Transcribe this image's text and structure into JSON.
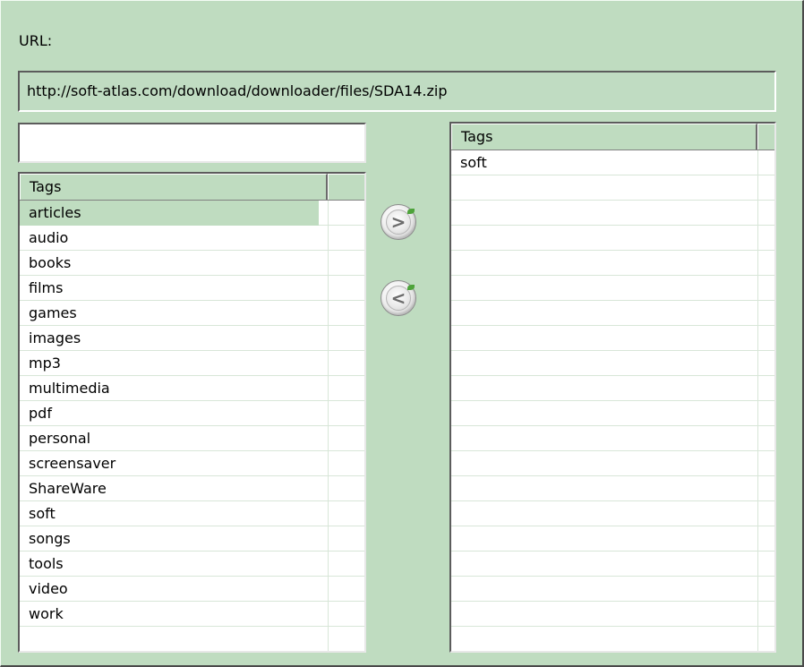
{
  "url_label": "URL:",
  "url_value": "http://soft-atlas.com/download/downloader/files/SDA14.zip",
  "filter": {
    "value": "",
    "placeholder": ""
  },
  "available_tags": {
    "header": "Tags",
    "selected_index": 0,
    "items": [
      "articles",
      "audio",
      "books",
      "films",
      "games",
      "images",
      "mp3",
      "multimedia",
      "pdf",
      "personal",
      "screensaver",
      "ShareWare",
      "soft",
      "songs",
      "tools",
      "video",
      "work"
    ]
  },
  "assigned_tags": {
    "header": "Tags",
    "items": [
      "soft"
    ]
  },
  "buttons": {
    "add_glyph": ">",
    "remove_glyph": "<"
  },
  "colors": {
    "panel_bg": "#bfdcc0",
    "selection": "#bfdcc0",
    "leaf_accent": "#4da33a"
  }
}
